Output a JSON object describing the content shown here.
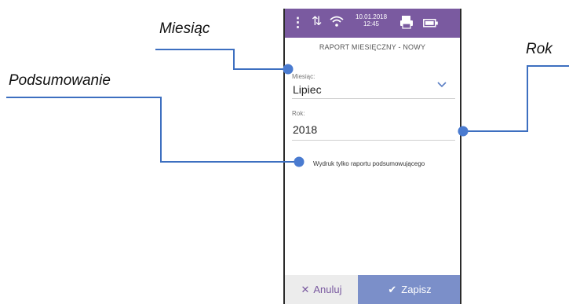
{
  "status_bar": {
    "menu_glyph": "⋮",
    "date": "10.01.2018",
    "time": "12:45",
    "color": "#7a5aa0"
  },
  "screen": {
    "title": "RAPORT MIESIĘCZNY - NOWY",
    "month_label": "Miesiąc:",
    "month_value": "Lipiec",
    "year_label": "Rok:",
    "year_value": "2018",
    "summary_option": "Wydruk tylko raportu podsumowującego"
  },
  "footer": {
    "cancel_label": "Anuluj",
    "save_label": "Zapisz",
    "save_color": "#7b8fc9"
  },
  "callouts": {
    "month": "Miesiąc",
    "summary": "Podsumowanie",
    "year": "Rok",
    "line_color": "#3d6fc0"
  }
}
